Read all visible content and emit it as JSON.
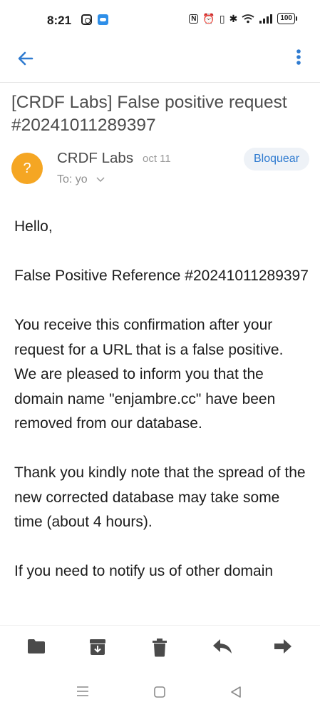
{
  "status_bar": {
    "time": "8:21",
    "battery": "100",
    "right_glyphs": [
      "N",
      "⏰",
      "▯",
      "✱"
    ]
  },
  "app_bar": {
    "back_icon": "arrow-left-icon",
    "more_icon": "more-vert-icon",
    "accent": "#2f7bd0"
  },
  "email": {
    "subject": "[CRDF Labs] False positive request #20241011289397",
    "sender": {
      "avatar_letter": "?",
      "avatar_color": "#f5a623",
      "name": "CRDF Labs",
      "date": "oct 11",
      "to": "To: yo"
    },
    "block_label": "Bloquear",
    "body": [
      "Hello,",
      "",
      "False Positive Reference #20241011289397",
      "",
      "You receive this confirmation after your request for a URL that is a false positive.",
      "We are pleased to inform you that the domain name \"enjambre.cc\" have been removed from our database.",
      "",
      "Thank you kindly note that the spread of the new corrected database may take some time (about 4 hours).",
      "",
      "If you need to notify us of other domain"
    ]
  },
  "toolbar": {
    "items": [
      "folder-icon",
      "archive-icon",
      "delete-icon",
      "reply-icon",
      "forward-icon"
    ]
  },
  "system_nav": {
    "items": [
      "menu-icon",
      "home-icon",
      "back-triangle-icon"
    ]
  }
}
